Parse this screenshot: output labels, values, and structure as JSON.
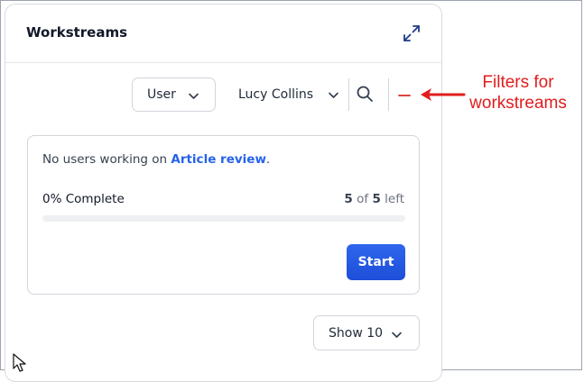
{
  "widget": {
    "title": "Workstreams"
  },
  "filters": {
    "type_value": "User",
    "assignee_value": "Lucy Collins"
  },
  "card": {
    "message_prefix": "No users working on ",
    "message_link": "Article review",
    "message_suffix": ".",
    "progress_label": "0% Complete",
    "progress_percent": 0,
    "remaining_done": "5",
    "remaining_of": " of ",
    "remaining_total": "5",
    "remaining_suffix": " left",
    "start_label": "Start"
  },
  "pagination": {
    "show_label": "Show 10"
  },
  "annotation": {
    "line1": "Filters for",
    "line2": "workstreams"
  },
  "colors": {
    "accent": "#2563eb",
    "annotation": "#e11d1d"
  },
  "icons": {
    "expand": "expand-icon",
    "search": "search-icon",
    "collapse": "minus-icon",
    "chevron": "chevron-down-icon"
  }
}
